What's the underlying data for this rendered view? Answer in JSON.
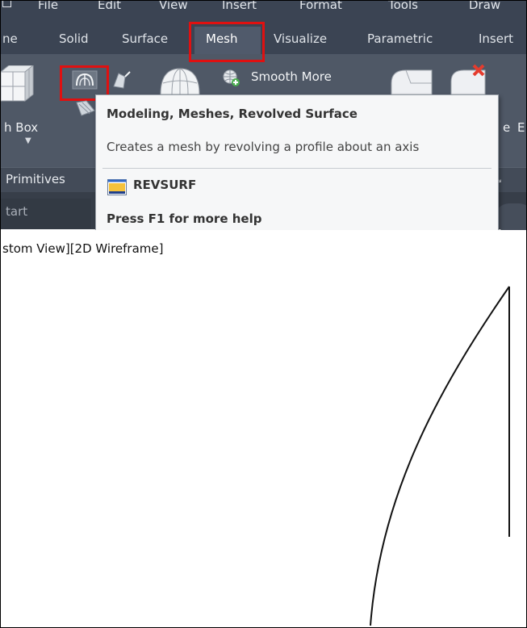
{
  "menubar": {
    "items": [
      "File",
      "Edit",
      "View",
      "Insert",
      "Format",
      "Tools",
      "Draw"
    ]
  },
  "ribbon_tabs": {
    "items": [
      "ne",
      "Solid",
      "Surface",
      "Mesh",
      "Visualize",
      "Parametric",
      "Insert"
    ],
    "active": "Mesh"
  },
  "ribbon": {
    "mesh_box_label": "h Box",
    "smooth_more_label": "Smooth More",
    "right_partial_label_1": "e",
    "right_partial_label_2": "E",
    "panel_title": "Primitives"
  },
  "file_tabs": {
    "start_label": "tart"
  },
  "tooltip": {
    "title": "Modeling, Meshes, Revolved Surface",
    "description": "Creates a mesh by revolving a profile about an axis",
    "command": "REVSURF",
    "help": "Press F1 for more help"
  },
  "viewport": {
    "label": "stom View][2D Wireframe]"
  },
  "icons": {
    "revolved_surface": "revolved-surface-icon",
    "edge_surface": "edge-surface-icon",
    "ruled_surface": "ruled-surface-icon",
    "mesh_box": "mesh-box-icon",
    "mesh_sphere": "mesh-sphere-icon",
    "smooth_more": "smooth-more-icon",
    "refine_mesh": "refine-mesh-icon",
    "delete_crease": "delete-crease-icon",
    "revsurf_command": "revsurf-command-icon"
  },
  "colors": {
    "highlight": "#e01010",
    "ribbon_bg": "#4f5866",
    "tab_bar_bg": "#3b4453"
  }
}
